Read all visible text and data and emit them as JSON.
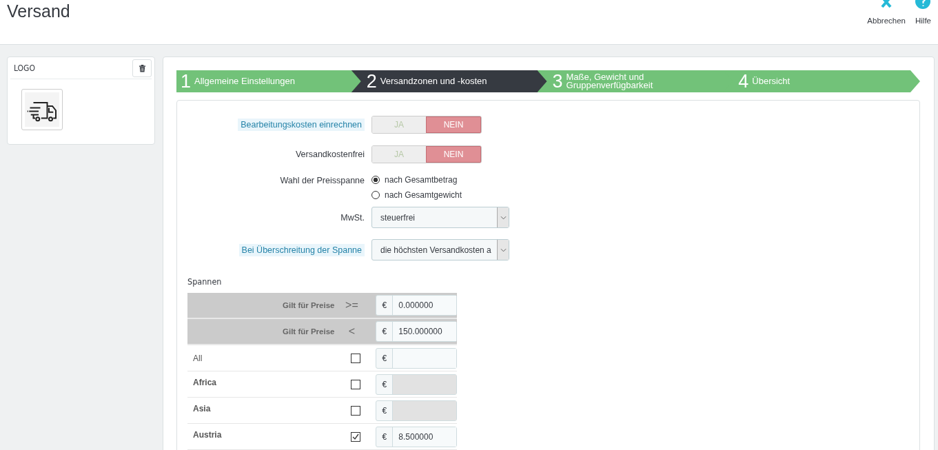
{
  "page_title": "Versand",
  "toolbar": [
    {
      "label": "Abbrechen"
    },
    {
      "label": "Hilfe"
    }
  ],
  "logo_card": {
    "title": "LOGO"
  },
  "steps": [
    {
      "number": "1",
      "label": "Allgemeine Einstellungen",
      "selected": false
    },
    {
      "number": "2",
      "label": "Versandzonen und -kosten",
      "selected": true
    },
    {
      "number": "3",
      "label": "Maße, Gewicht und Gruppenverfügbarkeit",
      "selected": false
    },
    {
      "number": "4",
      "label": "Übersicht",
      "selected": false
    }
  ],
  "fields": [
    {
      "kind": "toggle",
      "label": "Bearbeitungskosten einrechnen",
      "hint": true,
      "options": [
        {
          "label": "JA",
          "selected": false
        },
        {
          "label": "NEIN",
          "selected": true
        }
      ]
    },
    {
      "kind": "toggle",
      "label": "Versandkostenfrei",
      "hint": false,
      "options": [
        {
          "label": "JA",
          "selected": false
        },
        {
          "label": "NEIN",
          "selected": true
        }
      ]
    },
    {
      "kind": "radio",
      "label": "Wahl der Preisspanne",
      "hint": false,
      "options": [
        {
          "label": "nach Gesamtbetrag",
          "selected": true
        },
        {
          "label": "nach Gesamtgewicht",
          "selected": false
        }
      ]
    },
    {
      "kind": "select",
      "label": "MwSt.",
      "hint": false,
      "value": "steuerfrei"
    },
    {
      "kind": "select",
      "label": "Bei Überschreitung der Spanne",
      "hint": true,
      "value": "die höchsten Versandkosten a"
    }
  ],
  "ranges_title": "Spannen",
  "ranges": [
    {
      "label": "Gilt für Preise",
      "operator": ">=",
      "currency": "€",
      "value": "0.000000"
    },
    {
      "label": "Gilt für Preise",
      "operator": "<",
      "currency": "€",
      "value": "150.000000"
    }
  ],
  "zones": [
    {
      "kind": "all",
      "name": "All",
      "checked": false,
      "disabled": false,
      "currency": "€"
    },
    {
      "kind": "zone",
      "name": "Africa",
      "checked": false,
      "disabled": true,
      "currency": "€"
    },
    {
      "kind": "zone",
      "name": "Asia",
      "checked": false,
      "disabled": true,
      "currency": "€"
    },
    {
      "kind": "zone",
      "name": "Austria",
      "checked": true,
      "disabled": false,
      "currency": "€",
      "value": "8.500000"
    }
  ]
}
